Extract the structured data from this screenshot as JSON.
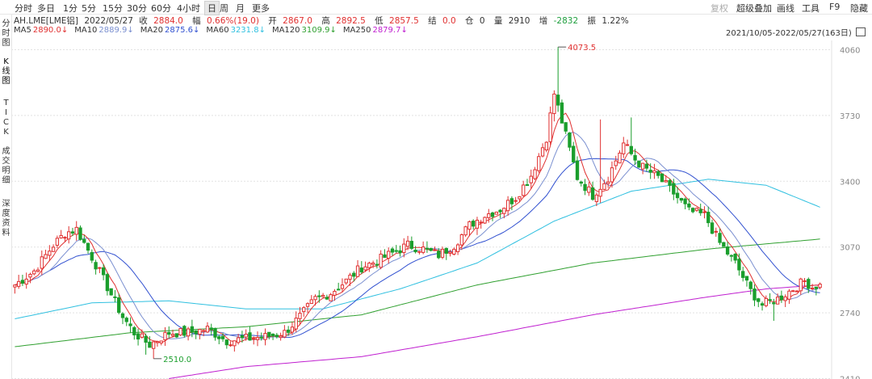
{
  "toolbar": {
    "left": [
      "分时",
      "多日",
      "1分",
      "5分",
      "15分",
      "30分",
      "60分",
      "4小时",
      "日",
      "周",
      "月",
      "更多"
    ],
    "active": "日",
    "right": [
      "复权",
      "超级叠加",
      "画线",
      "工具",
      "F9",
      "隐藏"
    ]
  },
  "sidebar": [
    "分时图",
    "K线图",
    "TICK",
    "成交明细",
    "深度资料"
  ],
  "sidebar_active": "K线图",
  "info": {
    "symbol": "AH.LME[LME铝]",
    "date": "2022/05/27",
    "close_label": "收",
    "close": "2884.0",
    "change_label": "幅",
    "change": "0.66%(19.0)",
    "open_label": "开",
    "open": "2867.0",
    "high_label": "高",
    "high": "2892.5",
    "low_label": "低",
    "low": "2857.5",
    "settle_label": "结",
    "settle": "0.0",
    "oi_label": "仓",
    "oi": "0",
    "vol_label": "量",
    "vol": "2910",
    "inc_label": "增",
    "inc": "-2832",
    "amp_label": "振",
    "amp": "1.22%"
  },
  "ma_legend": [
    {
      "label": "MA5",
      "value": "2890.0",
      "color": "#e03030"
    },
    {
      "label": "MA10",
      "value": "2889.9",
      "color": "#7a8fd0"
    },
    {
      "label": "MA20",
      "value": "2875.6",
      "color": "#3050d0"
    },
    {
      "label": "MA60",
      "value": "3231.8",
      "color": "#30c0e0"
    },
    {
      "label": "MA120",
      "value": "3109.9",
      "color": "#30a030"
    },
    {
      "label": "MA250",
      "value": "2879.7",
      "color": "#c020d0"
    }
  ],
  "range_text": "2021/10/05-2022/05/27(163日)",
  "chart_data": {
    "type": "candlestick",
    "y_ticks": [
      4060,
      3730,
      3400,
      3070,
      2740,
      2410
    ],
    "ylim": [
      2410,
      4060
    ],
    "grid": true,
    "colors": {
      "up": "#e03030",
      "down": "#1a9e2c"
    },
    "annotations": [
      {
        "text": "4073.5",
        "value": 4073.5
      },
      {
        "text": "2510.0",
        "value": 2510.0
      }
    ],
    "anchors": {
      "close": [
        [
          0,
          2880
        ],
        [
          5,
          2950
        ],
        [
          10,
          3080
        ],
        [
          13,
          3140
        ],
        [
          16,
          3160
        ],
        [
          20,
          3020
        ],
        [
          24,
          2870
        ],
        [
          28,
          2720
        ],
        [
          31,
          2640
        ],
        [
          35,
          2580
        ],
        [
          40,
          2640
        ],
        [
          45,
          2640
        ],
        [
          50,
          2660
        ],
        [
          55,
          2600
        ],
        [
          60,
          2610
        ],
        [
          65,
          2620
        ],
        [
          70,
          2640
        ],
        [
          74,
          2720
        ],
        [
          78,
          2810
        ],
        [
          82,
          2840
        ],
        [
          86,
          2900
        ],
        [
          90,
          2970
        ],
        [
          94,
          3000
        ],
        [
          98,
          3040
        ],
        [
          102,
          3080
        ],
        [
          106,
          3060
        ],
        [
          110,
          3030
        ],
        [
          114,
          3080
        ],
        [
          118,
          3180
        ],
        [
          122,
          3230
        ],
        [
          126,
          3260
        ],
        [
          130,
          3320
        ],
        [
          134,
          3430
        ],
        [
          138,
          3620
        ],
        [
          140,
          3840
        ],
        [
          142,
          3700
        ],
        [
          146,
          3420
        ],
        [
          150,
          3330
        ],
        [
          154,
          3420
        ],
        [
          158,
          3590
        ],
        [
          161,
          3510
        ],
        [
          163,
          3470
        ],
        [
          167,
          3420
        ],
        [
          171,
          3340
        ],
        [
          175,
          3250
        ],
        [
          179,
          3230
        ],
        [
          183,
          3090
        ],
        [
          187,
          2990
        ],
        [
          191,
          2850
        ],
        [
          194,
          2780
        ],
        [
          198,
          2810
        ],
        [
          202,
          2860
        ],
        [
          205,
          2900
        ],
        [
          207,
          2870
        ],
        [
          209,
          2884
        ]
      ],
      "lows": [
        [
          34,
          2530
        ],
        [
          36,
          2510
        ],
        [
          197,
          2700
        ],
        [
          140,
          3700
        ]
      ],
      "highs": [
        [
          141,
          4073.5
        ],
        [
          16,
          3200
        ],
        [
          160,
          3720
        ],
        [
          152,
          3710
        ]
      ],
      "ma60": [
        [
          0,
          2710
        ],
        [
          20,
          2790
        ],
        [
          40,
          2800
        ],
        [
          60,
          2760
        ],
        [
          80,
          2760
        ],
        [
          100,
          2860
        ],
        [
          120,
          2990
        ],
        [
          140,
          3200
        ],
        [
          160,
          3350
        ],
        [
          180,
          3410
        ],
        [
          195,
          3380
        ],
        [
          209,
          3270
        ]
      ],
      "ma120": [
        [
          0,
          2570
        ],
        [
          30,
          2640
        ],
        [
          60,
          2670
        ],
        [
          90,
          2730
        ],
        [
          120,
          2880
        ],
        [
          150,
          2990
        ],
        [
          180,
          3060
        ],
        [
          209,
          3110
        ]
      ],
      "ma250": [
        [
          40,
          2410
        ],
        [
          60,
          2470
        ],
        [
          90,
          2520
        ],
        [
          120,
          2620
        ],
        [
          150,
          2730
        ],
        [
          180,
          2820
        ],
        [
          195,
          2860
        ],
        [
          209,
          2880
        ]
      ]
    },
    "candle_count": 210
  }
}
